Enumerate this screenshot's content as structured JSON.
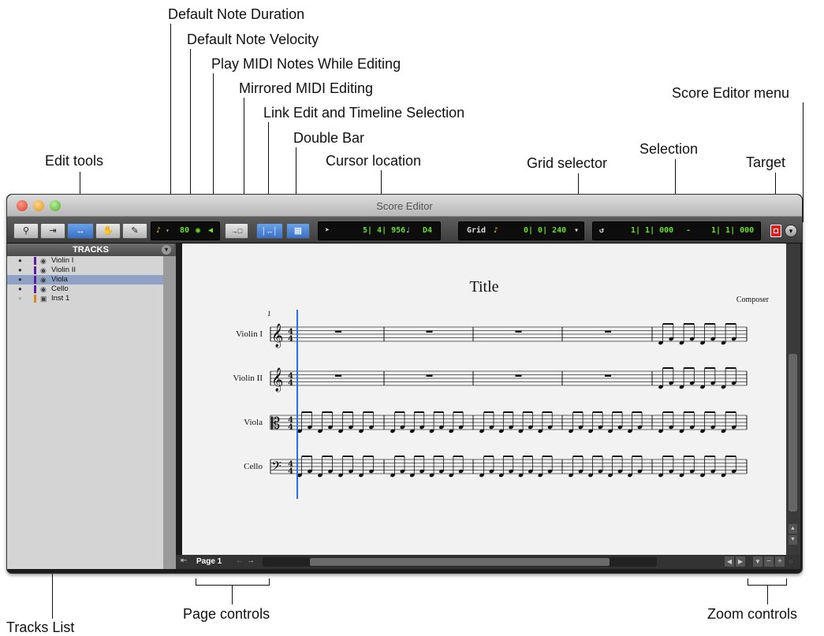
{
  "window": {
    "title": "Score Editor"
  },
  "callouts": {
    "default_note_duration": "Default Note Duration",
    "default_note_velocity": "Default Note Velocity",
    "play_midi_notes": "Play MIDI Notes While Editing",
    "mirrored_midi": "Mirrored MIDI Editing",
    "link_edit": "Link Edit and Timeline Selection",
    "double_bar": "Double Bar",
    "cursor_location": "Cursor location",
    "edit_tools": "Edit tools",
    "grid_selector": "Grid selector",
    "selection": "Selection",
    "target": "Target",
    "score_editor_menu": "Score Editor menu",
    "tracks_list": "Tracks List",
    "page_controls": "Page controls",
    "zoom_controls": "Zoom controls"
  },
  "toolbar": {
    "velocity": "80",
    "cursor_location": "5| 4| 956",
    "cursor_pitch": "D4",
    "grid_label": "Grid",
    "grid_value": "0| 0| 240",
    "selection_start": "1| 1| 000",
    "selection_sep": "-",
    "selection_end": "1| 1| 000"
  },
  "tracks_panel": {
    "header": "TRACKS",
    "items": [
      {
        "name": "Violin I",
        "color": "#5a1fa0"
      },
      {
        "name": "Violin II",
        "color": "#5a1fa0"
      },
      {
        "name": "Viola",
        "color": "#5a1fa0"
      },
      {
        "name": "Cello",
        "color": "#5a1fa0"
      },
      {
        "name": "Inst 1",
        "color": "#d68a1a"
      }
    ]
  },
  "score": {
    "title": "Title",
    "composer": "Composer",
    "measure_number": "1",
    "staves": [
      {
        "name": "Violin I",
        "clef": "treble",
        "time_signature": "4/4"
      },
      {
        "name": "Violin II",
        "clef": "treble",
        "time_signature": "4/4"
      },
      {
        "name": "Viola",
        "clef": "alto",
        "time_signature": "4/4"
      },
      {
        "name": "Cello",
        "clef": "bass",
        "time_signature": "4/4"
      }
    ]
  },
  "page_nav": {
    "label": "Page 1"
  }
}
